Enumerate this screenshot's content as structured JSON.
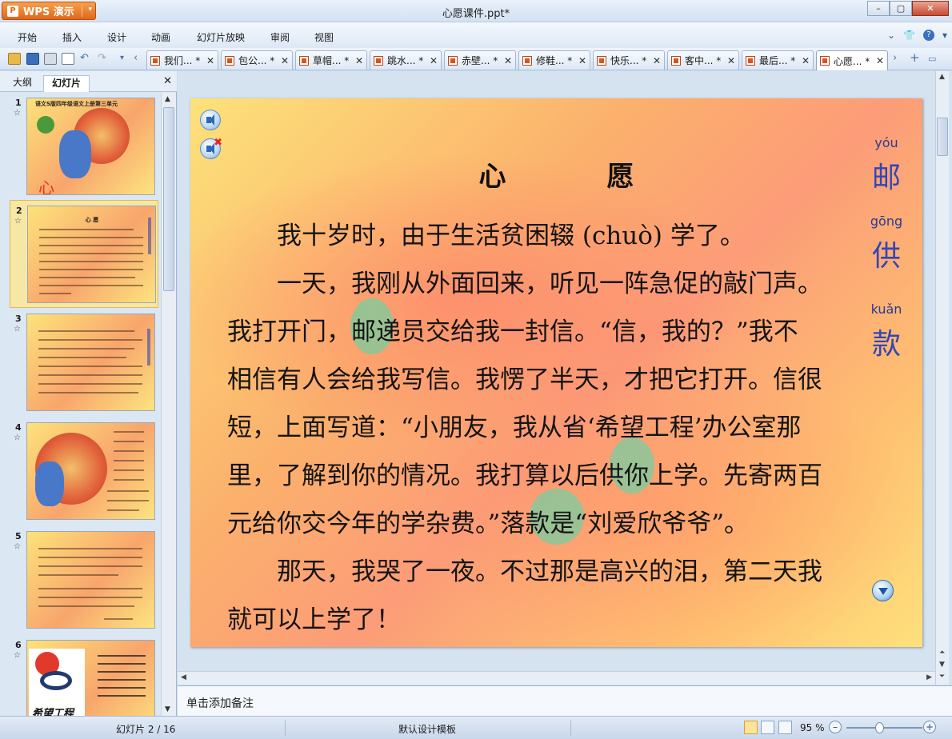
{
  "window": {
    "app_name": "WPS 演示",
    "app_logo": "P",
    "title": "心愿课件.ppt*",
    "controls": [
      "–",
      "▢",
      "✕"
    ]
  },
  "menu": {
    "items": [
      "开始",
      "插入",
      "设计",
      "动画",
      "幻灯片放映",
      "审阅",
      "视图"
    ]
  },
  "doc_tabs": [
    {
      "label": "我们... *",
      "active": false
    },
    {
      "label": "包公... *",
      "active": false
    },
    {
      "label": "草帽... *",
      "active": false
    },
    {
      "label": "跳水... *",
      "active": false
    },
    {
      "label": "赤壁... *",
      "active": false
    },
    {
      "label": "修鞋... *",
      "active": false
    },
    {
      "label": "快乐... *",
      "active": false
    },
    {
      "label": "客中... *",
      "active": false
    },
    {
      "label": "最后... *",
      "active": false
    },
    {
      "label": "心愿... *",
      "active": true
    }
  ],
  "left_panel": {
    "tab_outline": "大纲",
    "tab_slides": "幻灯片",
    "close": "✕",
    "slides": [
      {
        "num": "1",
        "title": "心　愿",
        "header": "语文S版四年级语文上册第三单元"
      },
      {
        "num": "2",
        "selected": true,
        "title": "心 愿"
      },
      {
        "num": "3"
      },
      {
        "num": "4"
      },
      {
        "num": "5"
      },
      {
        "num": "6",
        "caption": "希望工程"
      }
    ]
  },
  "slide": {
    "title": "心　愿",
    "paragraphs": [
      "　　我十岁时，由于生活贫困辍 (chuò) 学了。",
      "　　一天，我刚从外面回来，听见一阵急促的敲门声。",
      "我打开门，邮递员交给我一封信。“信，我的？”我不",
      "相信有人会给我写信。我愣了半天，才把它打开。信很",
      "短，上面写道：“小朋友，我从省‘希望工程’办公室那",
      "里，了解到你的情况。我打算以后供你上学。先寄两百",
      "元给你交今年的学杂费。”落款是“刘爱欣爷爷”。",
      "　　那天，我哭了一夜。不过那是高兴的泪，第二天我",
      "就可以上学了！"
    ],
    "vocab": [
      {
        "pinyin": "yóu",
        "char": "邮"
      },
      {
        "pinyin": "gōng",
        "char": "供"
      },
      {
        "pinyin": "kuǎn",
        "char": "款"
      }
    ]
  },
  "notes": {
    "placeholder": "单击添加备注"
  },
  "status": {
    "slide_indicator": "幻灯片 2 / 16",
    "template": "默认设计模板",
    "zoom": "95 %",
    "zoom_level_percent": 95
  },
  "colors": {
    "accent_orange": "#e0661a",
    "pinyin": "#2b3c8f",
    "vocab_char": "#3346b5",
    "highlight": "#78cda0"
  }
}
